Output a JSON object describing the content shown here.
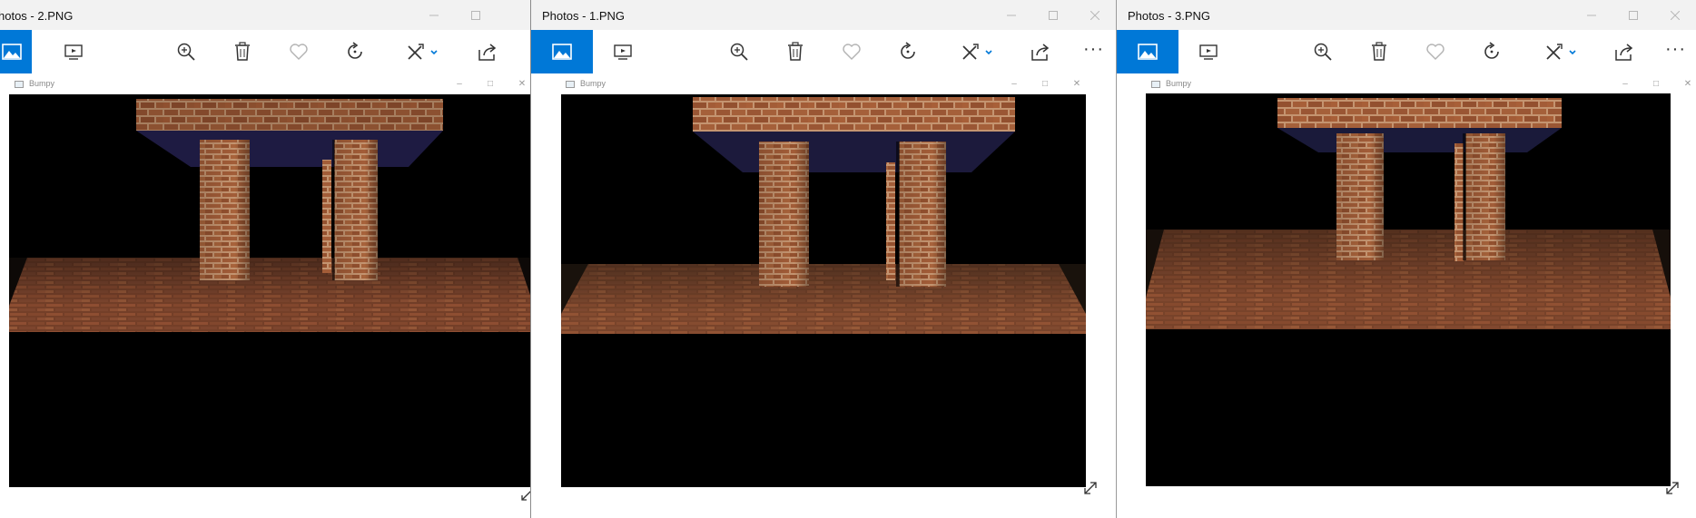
{
  "windows": [
    {
      "title": "hotos - 2.PNG",
      "toolbar": [
        "view-image-icon",
        "slideshow-icon",
        "zoom-in-icon",
        "delete-icon",
        "favorite-icon",
        "rotate-icon",
        "edit-icon",
        "share-icon"
      ],
      "inner_window_title": "Bumpy",
      "render_variant": "sharp"
    },
    {
      "title": "Photos - 1.PNG",
      "toolbar": [
        "view-image-icon",
        "slideshow-icon",
        "zoom-in-icon",
        "delete-icon",
        "favorite-icon",
        "rotate-icon",
        "edit-icon",
        "share-icon",
        "more-icon"
      ],
      "more_label": "···",
      "inner_window_title": "Bumpy",
      "render_variant": "smooth"
    },
    {
      "title": "Photos - 3.PNG",
      "toolbar": [
        "view-image-icon",
        "slideshow-icon",
        "zoom-in-icon",
        "delete-icon",
        "favorite-icon",
        "rotate-icon",
        "edit-icon",
        "share-icon",
        "more-icon"
      ],
      "more_label": "···",
      "inner_window_title": "Bumpy",
      "render_variant": "close"
    }
  ],
  "colors": {
    "accent": "#0078d7",
    "titlebar": "#f2f2f2",
    "brick": "#9a5634",
    "mortar": "#c8a07a",
    "ceiling": "#1c1a3c",
    "floor": "#7a4026"
  }
}
